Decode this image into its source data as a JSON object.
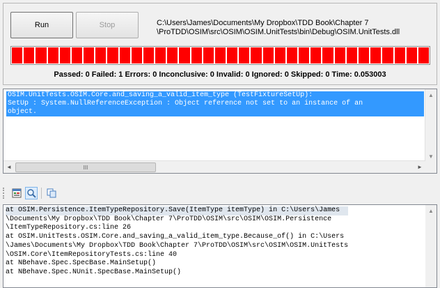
{
  "toolbar": {
    "run_label": "Run",
    "stop_label": "Stop"
  },
  "assembly_path": {
    "line1": "C:\\Users\\James\\Documents\\My Dropbox\\TDD Book\\Chapter 7",
    "line2": "\\ProTDD\\OSIM\\src\\OSIM\\OSIM.UnitTests\\bin\\Debug\\OSIM.UnitTests.dll"
  },
  "progress": {
    "fraction": 1.0,
    "color": "#ff0000",
    "segments": 35
  },
  "summary": "Passed: 0  Failed: 1  Errors: 0  Inconclusive: 0  Invalid: 0  Ignored: 0  Skipped: 0  Time: 0.053003",
  "results": {
    "selected_item": "OSIM.UnitTests.OSIM.Core.and_saving_a_valid_item_type (TestFixtureSetUp):\nSetUp : System.NullReferenceException : Object reference not set to an instance of an\nobject.",
    "selection_color": "#3399ff"
  },
  "scrollbar": {
    "up_arrow": "▲",
    "down_arrow": "▼",
    "left_arrow": "◄",
    "right_arrow": "►",
    "thumb_grip": "III"
  },
  "detail_toolbar": {
    "icons": [
      "output-icon",
      "find-icon",
      "copy-icon"
    ]
  },
  "stack_trace": [
    "at OSIM.Persistence.ItemTypeRepository.Save(ItemType itemType) in C:\\Users\\James",
    "\\Documents\\My Dropbox\\TDD Book\\Chapter 7\\ProTDD\\OSIM\\src\\OSIM\\OSIM.Persistence",
    "\\ItemTypeRepository.cs:line 26",
    "at OSIM.UnitTests.OSIM.Core.and_saving_a_valid_item_type.Because_of() in C:\\Users",
    "\\James\\Documents\\My Dropbox\\TDD Book\\Chapter 7\\ProTDD\\OSIM\\src\\OSIM\\OSIM.UnitTests",
    "\\OSIM.Core\\ItemRepositoryTests.cs:line 40",
    "at NBehave.Spec.SpecBase.MainSetup()",
    "at NBehave.Spec.NUnit.SpecBase.MainSetup()"
  ]
}
